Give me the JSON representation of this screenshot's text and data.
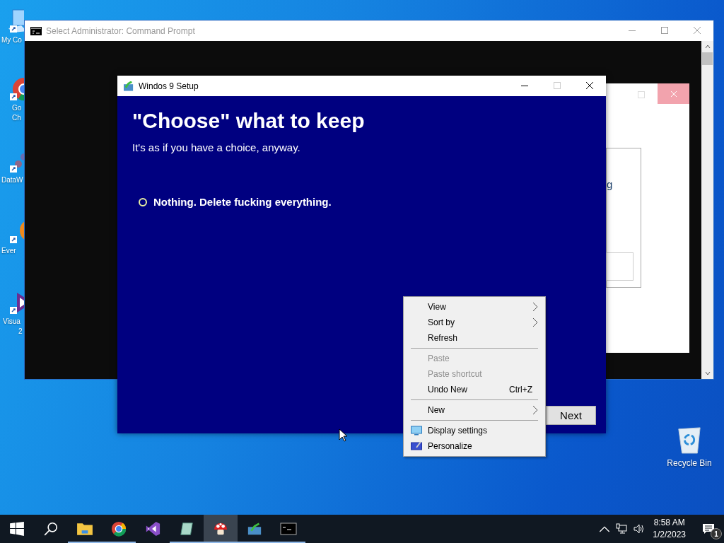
{
  "desktop_icons": [
    {
      "label_lines": [
        "My Co"
      ]
    },
    {
      "label_lines": [
        "Go",
        "Ch"
      ]
    },
    {
      "label_lines": [
        "DataW"
      ]
    },
    {
      "label_lines": [
        "Ever"
      ]
    },
    {
      "label_lines": [
        "Visua",
        "2"
      ]
    }
  ],
  "recycle_bin": {
    "label": "Recycle Bin"
  },
  "cmd_window": {
    "title": "Select Administrator:  Command Prompt"
  },
  "back_window": {
    "text_fragment": "g"
  },
  "setup_window": {
    "title": "Windos 9 Setup",
    "heading": "\"Choose\" what to keep",
    "subtitle": "It's as if you have a choice, anyway.",
    "options": [
      {
        "label": "Nothing. Delete fucking everything.",
        "selected": false
      }
    ],
    "next_button": "Next"
  },
  "context_menu": {
    "groups": [
      [
        {
          "label": "View",
          "submenu": true,
          "disabled": false
        },
        {
          "label": "Sort by",
          "submenu": true,
          "disabled": false
        },
        {
          "label": "Refresh",
          "submenu": false,
          "disabled": false
        }
      ],
      [
        {
          "label": "Paste",
          "submenu": false,
          "disabled": true
        },
        {
          "label": "Paste shortcut",
          "submenu": false,
          "disabled": true
        },
        {
          "label": "Undo New",
          "shortcut": "Ctrl+Z",
          "submenu": false,
          "disabled": false
        }
      ],
      [
        {
          "label": "New",
          "submenu": true,
          "disabled": false
        }
      ],
      [
        {
          "label": "Display settings",
          "submenu": false,
          "disabled": false,
          "kind": "display"
        },
        {
          "label": "Personalize",
          "submenu": false,
          "disabled": false,
          "kind": "personalize"
        }
      ]
    ]
  },
  "taskbar": {
    "apps": [
      {
        "kind": "start",
        "running": false,
        "active": false
      },
      {
        "kind": "search",
        "running": false,
        "active": false
      },
      {
        "kind": "folder",
        "running": true,
        "active": false
      },
      {
        "kind": "chrome",
        "running": true,
        "active": false
      },
      {
        "kind": "vs",
        "running": false,
        "active": false
      },
      {
        "kind": "notepad",
        "running": true,
        "active": false
      },
      {
        "kind": "mushroom",
        "running": true,
        "active": true
      },
      {
        "kind": "setup",
        "running": true,
        "active": false
      },
      {
        "kind": "cmd",
        "running": true,
        "active": false
      }
    ],
    "time": "8:58 AM",
    "date": "1/2/2023",
    "notification_count": "1"
  }
}
